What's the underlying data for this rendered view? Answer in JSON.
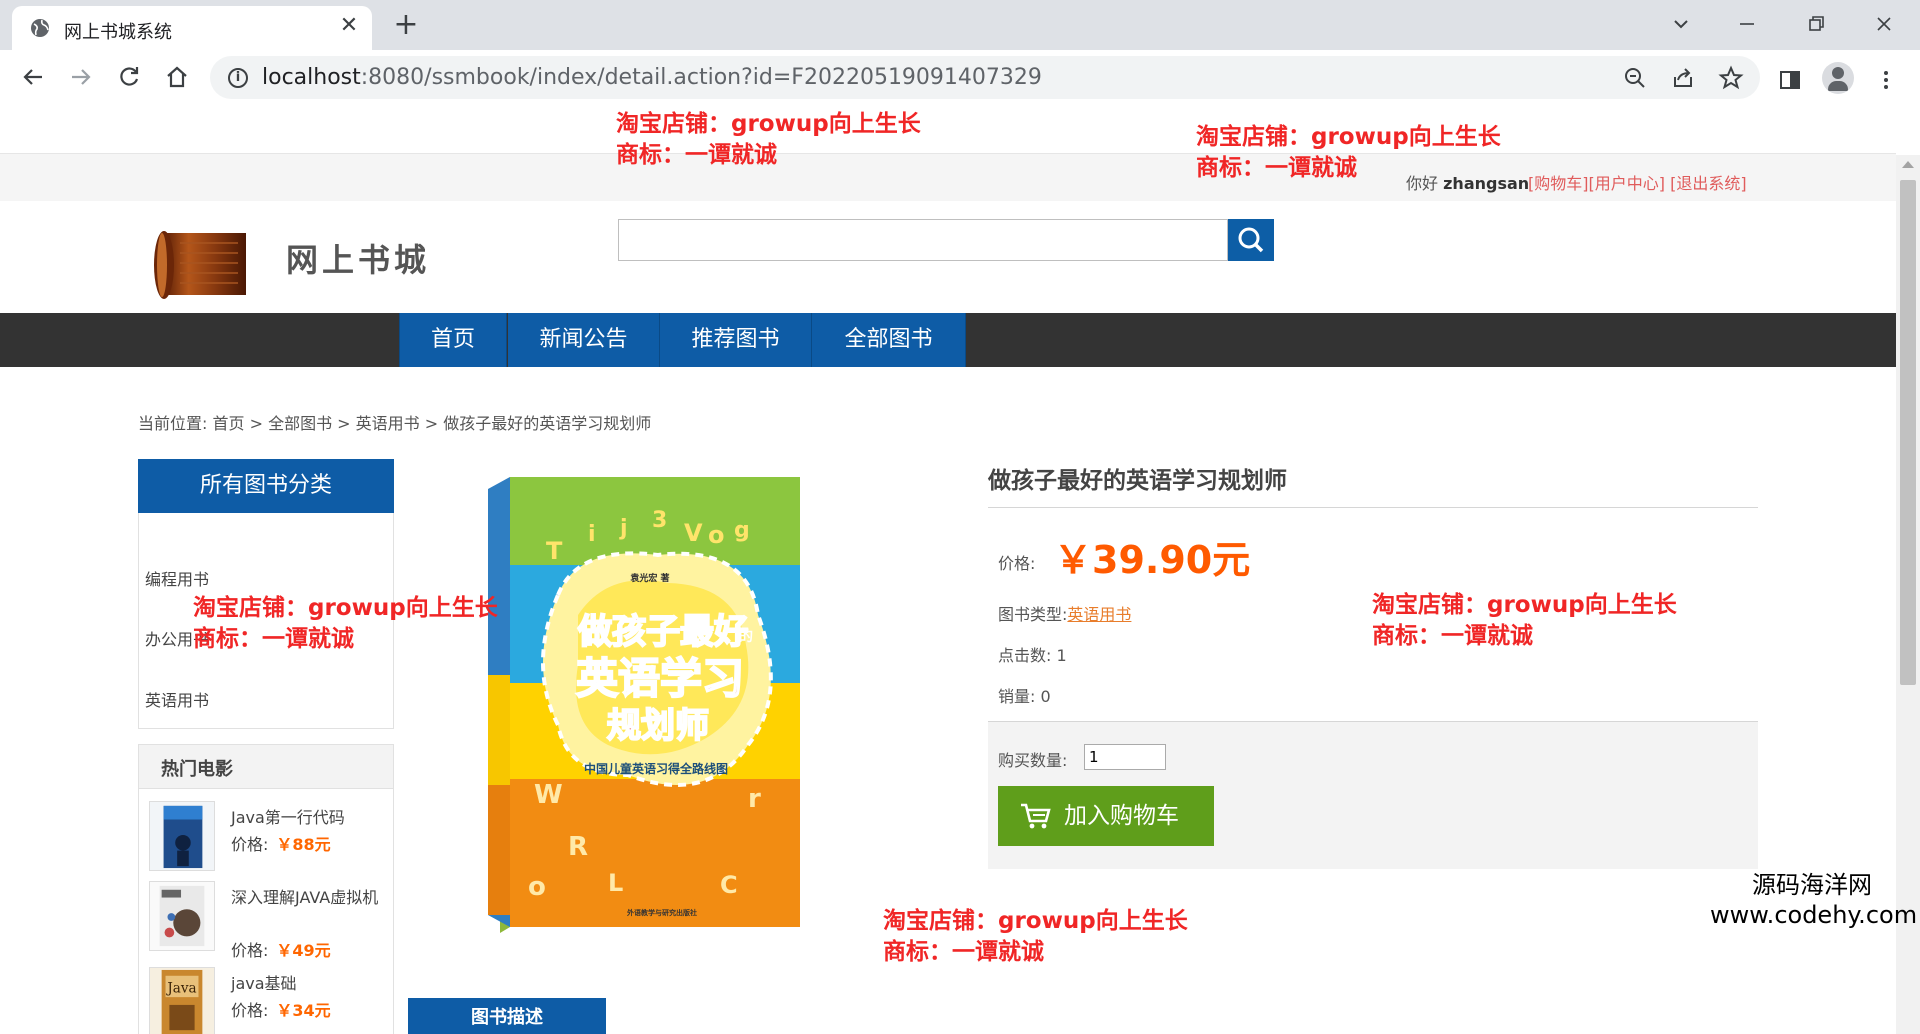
{
  "browser": {
    "tab_title": "网上书城系统",
    "tab_close": "✕",
    "new_tab": "+",
    "url_host": "localhost",
    "url_rest": ":8080/ssmbook/index/detail.action?id=F20220519091407329",
    "icons": [
      "globe-icon",
      "back-icon",
      "forward-icon",
      "reload-icon",
      "home-icon",
      "info-icon",
      "zoom-icon",
      "share-icon",
      "star-icon",
      "sidepanel-icon",
      "profile-icon",
      "menu-icon"
    ]
  },
  "site": {
    "user_greeting": "你好",
    "username": "zhangsan",
    "links": [
      "[购物车]",
      "[用户中心]",
      "[退出系统]"
    ],
    "title": "网上书城",
    "search_value": "",
    "nav": [
      "首页",
      "新闻公告",
      "推荐图书",
      "全部图书"
    ]
  },
  "breadcrumb": {
    "prefix": "当前位置: ",
    "items": [
      "首页",
      "全部图书",
      "英语用书",
      "做孩子最好的英语学习规划师"
    ],
    "sep": " > "
  },
  "sidebar": {
    "category_header": "所有图书分类",
    "categories": [
      "编程用书",
      "办公用书",
      "英语用书"
    ],
    "hot_header": "热门电影",
    "hot_items": [
      {
        "name": "Java第一行代码",
        "price_label": "价格:",
        "price": "￥88元"
      },
      {
        "name": "深入理解JAVA虚拟机",
        "price_label": "价格:",
        "price": "￥49元"
      },
      {
        "name": "java基础",
        "price_label": "价格:",
        "price": "￥34元"
      }
    ]
  },
  "product": {
    "title": "做孩子最好的英语学习规划师",
    "price_label": "价格:",
    "price": "￥39.90元",
    "type_label": "图书类型:",
    "type_value": "英语用书",
    "clicks_label": "点击数:",
    "clicks": "1",
    "sales_label": "销量:",
    "sales": "0",
    "qty_label": "购买数量:",
    "qty": "1",
    "add_cart": "加入购物车",
    "desc_tab": "图书描述",
    "cover_text": {
      "line1": "做孩子最好",
      "line1_small": "的",
      "line2": "英语学习",
      "line3": "规划师",
      "subtitle": "中国儿童英语习得全路线图",
      "author": "袁光宏 著",
      "publisher": "外语教学与研究出版社"
    }
  },
  "watermark": {
    "line1": "淘宝店铺：growup向上生长",
    "line2": "商标：一谭就诚"
  },
  "corner_mark": {
    "line1": "源码海洋网",
    "line2": "www.codehy.com"
  },
  "colors": {
    "brand_blue": "#0e5ca6",
    "nav_dark": "#333333",
    "price_orange": "#ff5a00",
    "cart_green": "#5f9e1b",
    "watermark_red": "#f02626"
  }
}
